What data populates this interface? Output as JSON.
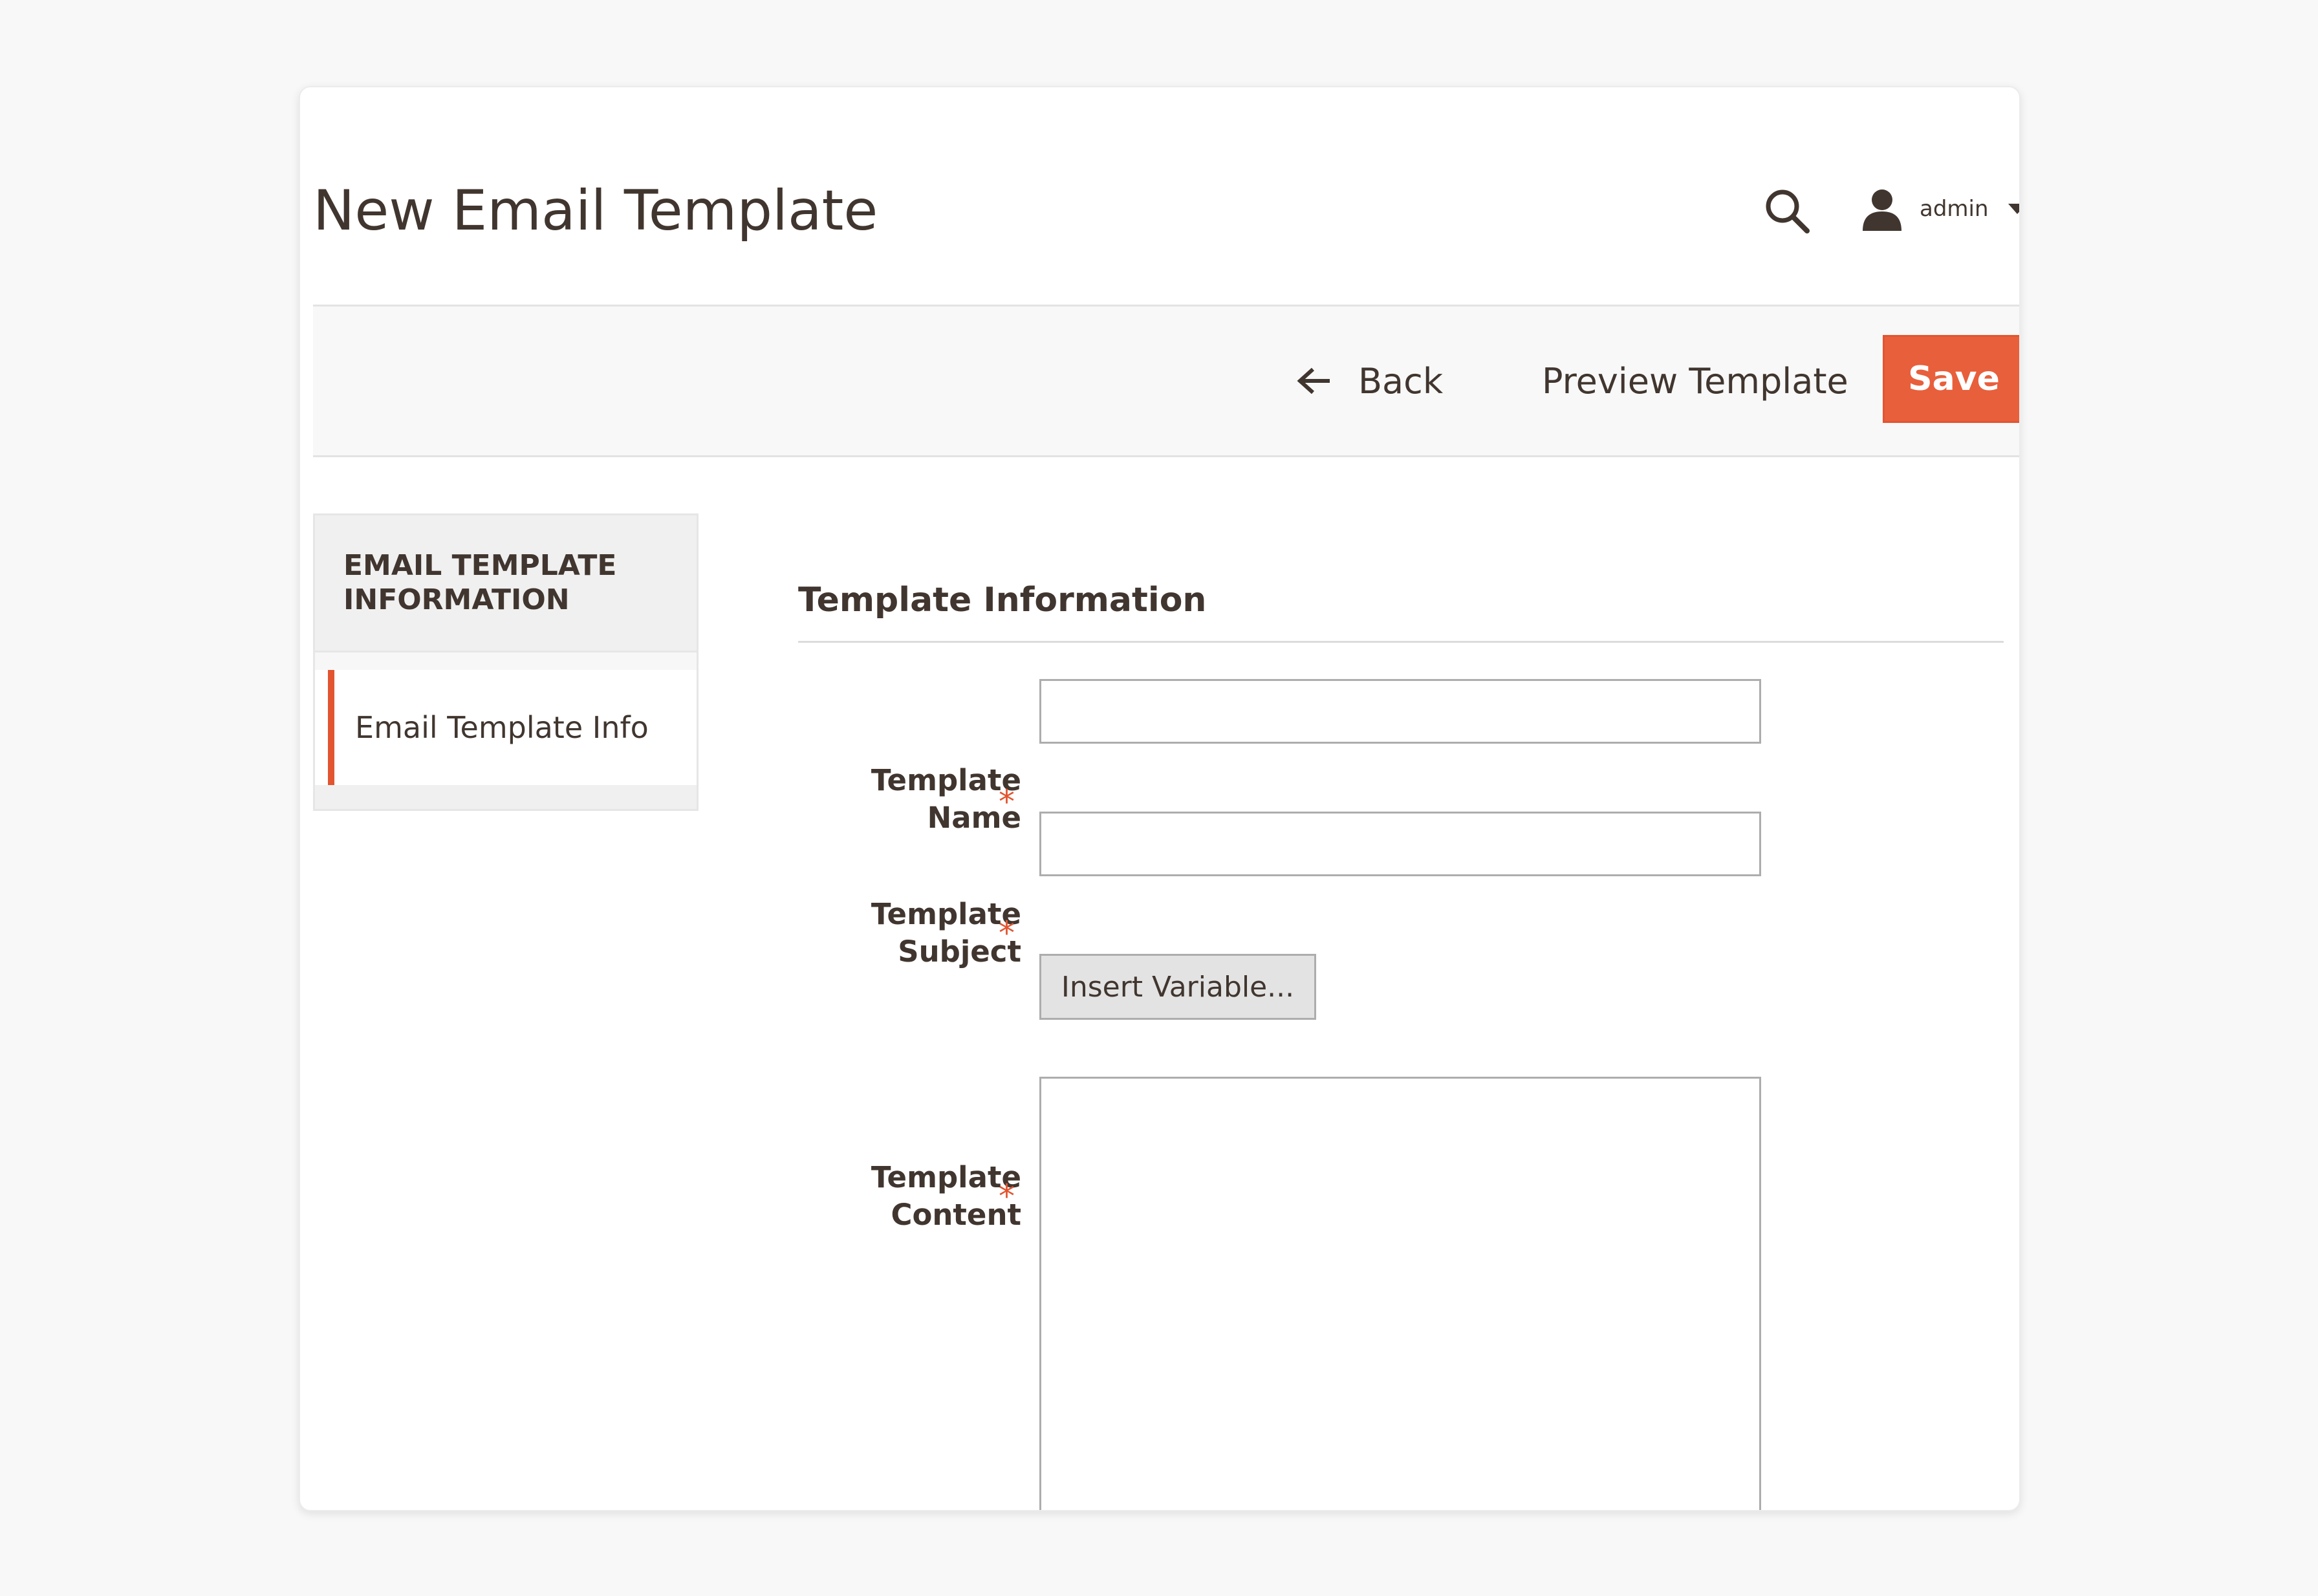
{
  "header": {
    "title": "New Email Template",
    "search_icon": "search-icon",
    "user": {
      "name": "admin",
      "icon": "user-icon"
    }
  },
  "actions": {
    "back_label": "Back",
    "preview_label": "Preview Template",
    "save_label": "Save"
  },
  "sidebar": {
    "heading_line1": "EMAIL TEMPLATE",
    "heading_line2": "INFORMATION",
    "items": [
      {
        "label": "Email Template Info",
        "active": true
      }
    ]
  },
  "form": {
    "section_title": "Template Information",
    "fields": {
      "name": {
        "label_line1": "Template",
        "label_line2": "Name",
        "required_mark": "*",
        "value": ""
      },
      "subject": {
        "label_line1": "Template",
        "label_line2": "Subject",
        "required_mark": "*",
        "value": ""
      },
      "content": {
        "label_line1": "Template",
        "label_line2": "Content",
        "required_mark": "*",
        "value": ""
      }
    },
    "insert_variable_label": "Insert Variable..."
  },
  "colors": {
    "accent": "#e85f3b",
    "text": "#41362f",
    "background": "#f8f8f8"
  }
}
